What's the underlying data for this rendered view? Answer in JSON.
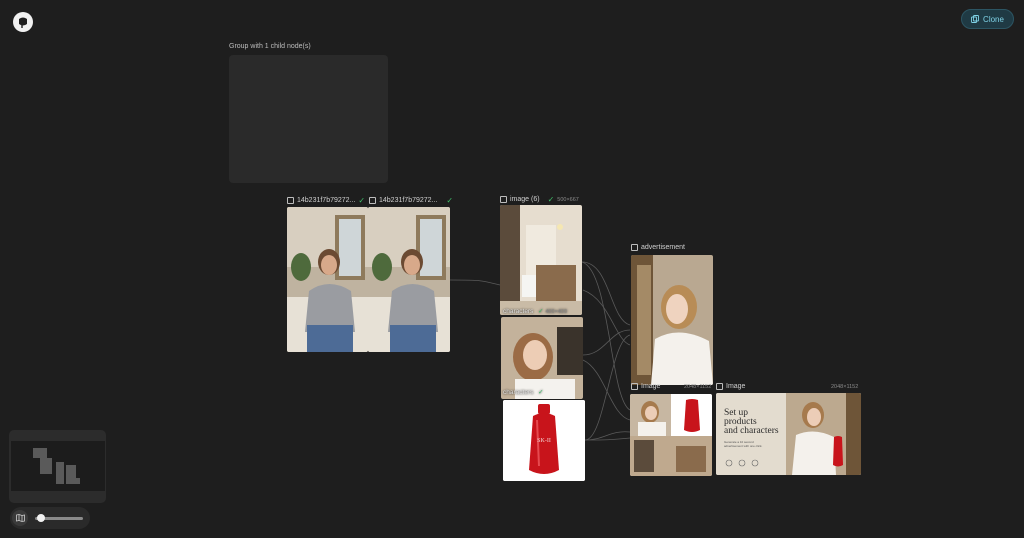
{
  "toolbar": {
    "clone_label": "Clone"
  },
  "group": {
    "label": "Group with 1 child node(s)"
  },
  "nodes": {
    "video_a": {
      "title": "14b231f7b79272..."
    },
    "video_b": {
      "title": "14b231f7b79272..."
    },
    "image6": {
      "title": "image (6)",
      "dims": "500×667"
    },
    "characters_a": {
      "label": "characters",
      "dims": "400×400"
    },
    "characters_b": {
      "label": "characters"
    },
    "advertisement": {
      "title": "advertisement"
    },
    "image_small": {
      "title": "Image",
      "dims": "2048×1152"
    },
    "image_ad": {
      "title": "Image",
      "dims": "2048×1152"
    },
    "ad_card": {
      "headline_1": "Set up",
      "headline_2": "products",
      "headline_3": "and characters",
      "sub": "Generate a 10 second advertisement with one click."
    },
    "product_brand": "SK-II"
  },
  "zoom": {
    "level": 0.08
  },
  "colors": {
    "background": "#1e1e1e",
    "accent": "#7fd2e6",
    "ok": "#3fbf6a",
    "product_red": "#c8141b"
  }
}
